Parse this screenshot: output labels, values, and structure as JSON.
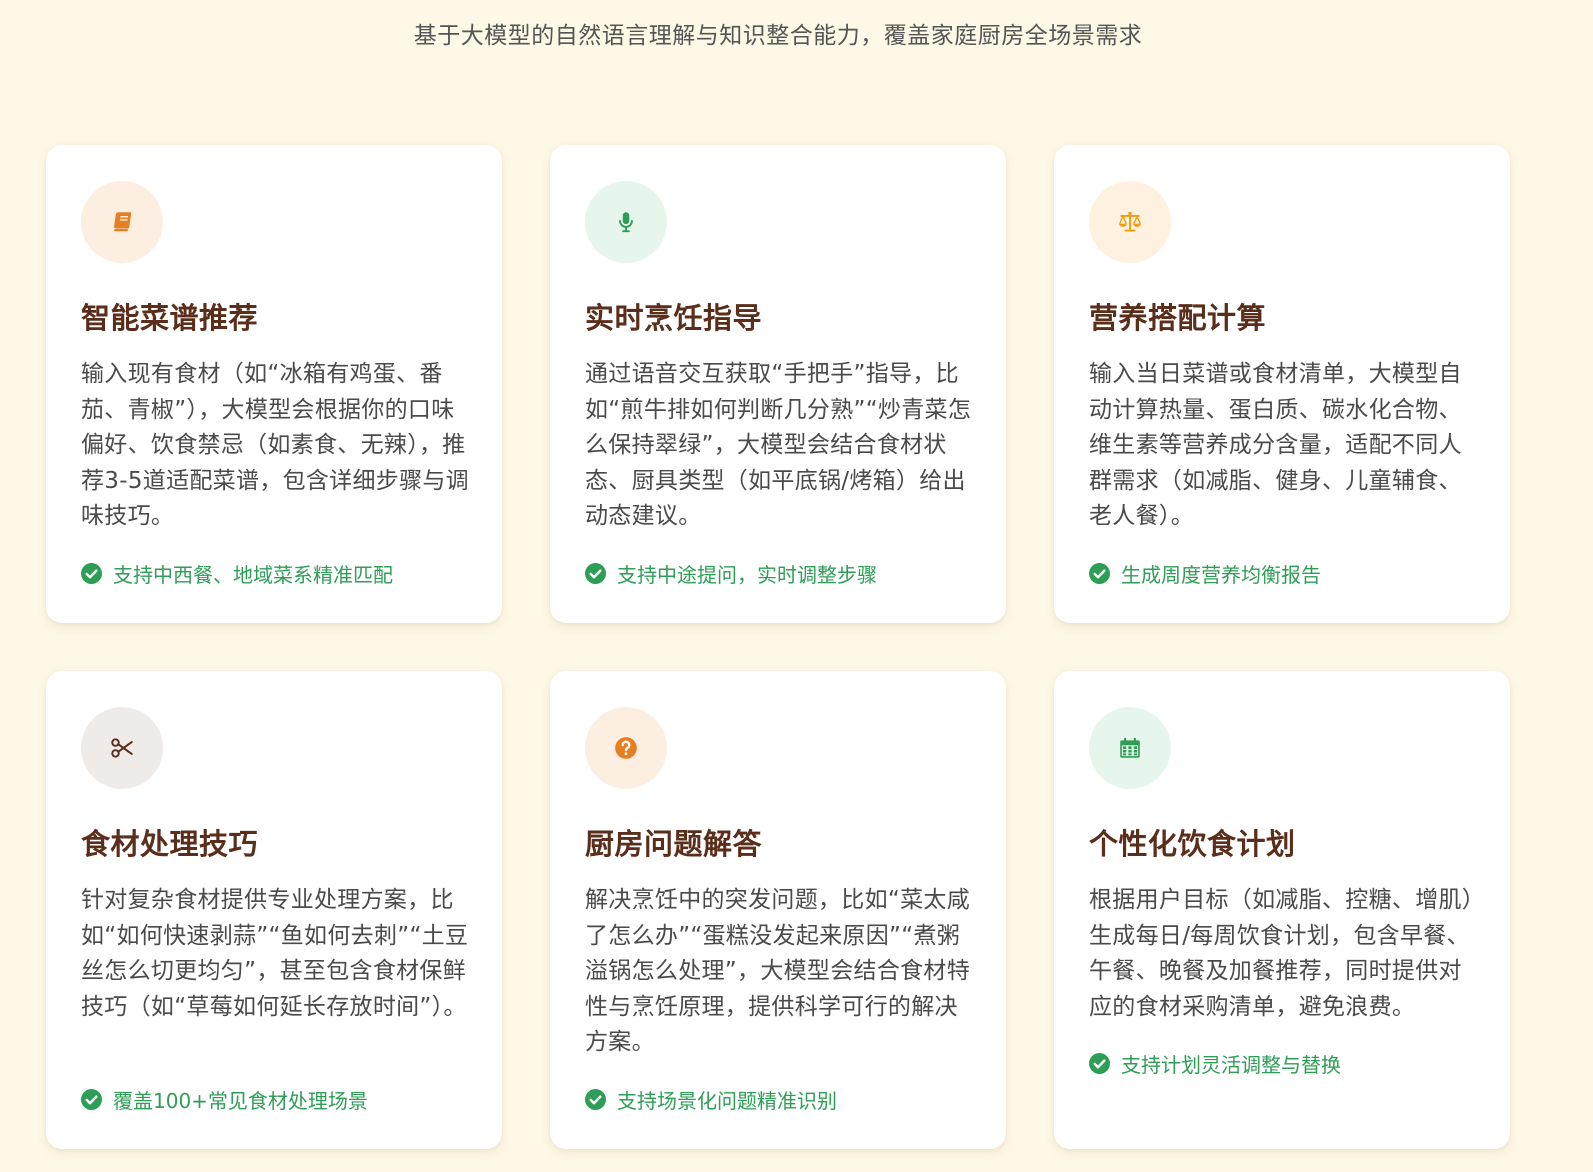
{
  "header": {
    "subtitle": "基于大模型的自然语言理解与知识整合能力，覆盖家庭厨房全场景需求"
  },
  "colors": {
    "page_background": "#fef8e6",
    "title_brown": "#5a2e1a",
    "feature_green": "#2e9e56"
  },
  "cards": [
    {
      "icon": "book-icon",
      "title": "智能菜谱推荐",
      "description": "输入现有食材（如“冰箱有鸡蛋、番茄、青椒”），大模型会根据你的口味偏好、饮食禁忌（如素食、无辣），推荐3-5道适配菜谱，包含详细步骤与调味技巧。",
      "feature": "支持中西餐、地域菜系精准匹配"
    },
    {
      "icon": "microphone-icon",
      "title": "实时烹饪指导",
      "description": "通过语音交互获取“手把手”指导，比如“煎牛排如何判断几分熟”“炒青菜怎么保持翠绿”，大模型会结合食材状态、厨具类型（如平底锅/烤箱）给出动态建议。",
      "feature": "支持中途提问，实时调整步骤"
    },
    {
      "icon": "balance-scale-icon",
      "title": "营养搭配计算",
      "description": "输入当日菜谱或食材清单，大模型自动计算热量、蛋白质、碳水化合物、维生素等营养成分含量，适配不同人群需求（如减脂、健身、儿童辅食、老人餐）。",
      "feature": "生成周度营养均衡报告"
    },
    {
      "icon": "scissors-icon",
      "title": "食材处理技巧",
      "description": "针对复杂食材提供专业处理方案，比如“如何快速剥蒜”“鱼如何去刺”“土豆丝怎么切更均匀”，甚至包含食材保鲜技巧（如“草莓如何延长存放时间”）。",
      "feature": "覆盖100+常见食材处理场景"
    },
    {
      "icon": "question-circle-icon",
      "title": "厨房问题解答",
      "description": "解决烹饪中的突发问题，比如“菜太咸了怎么办”“蛋糕没发起来原因”“煮粥溢锅怎么处理”，大模型会结合食材特性与烹饪原理，提供科学可行的解决方案。",
      "feature": "支持场景化问题精准识别"
    },
    {
      "icon": "calendar-icon",
      "title": "个性化饮食计划",
      "description": "根据用户目标（如减脂、控糖、增肌）生成每日/每周饮食计划，包含早餐、午餐、晚餐及加餐推荐，同时提供对应的食材采购清单，避免浪费。",
      "feature": "支持计划灵活调整与替换"
    }
  ]
}
